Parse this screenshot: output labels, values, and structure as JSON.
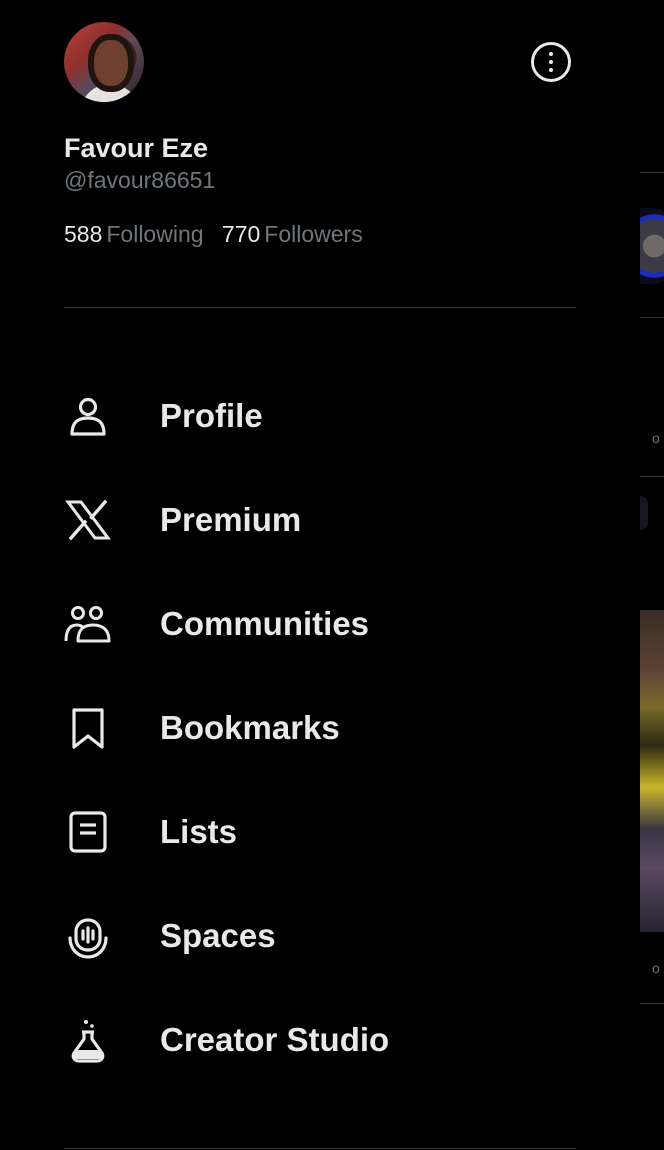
{
  "profile": {
    "display_name": "Favour Eze",
    "handle": "@favour86651",
    "following_count": "588",
    "following_label": "Following",
    "followers_count": "770",
    "followers_label": "Followers"
  },
  "menu": {
    "items": [
      {
        "label": "Profile",
        "icon": "person-icon"
      },
      {
        "label": "Premium",
        "icon": "x-logo-icon"
      },
      {
        "label": "Communities",
        "icon": "communities-icon"
      },
      {
        "label": "Bookmarks",
        "icon": "bookmark-icon"
      },
      {
        "label": "Lists",
        "icon": "list-icon"
      },
      {
        "label": "Spaces",
        "icon": "spaces-icon"
      },
      {
        "label": "Creator Studio",
        "icon": "flask-icon"
      }
    ]
  },
  "colors": {
    "background": "#000000",
    "primary_text": "#e7e9ea",
    "secondary_text": "#71767b",
    "divider": "#2f3336"
  }
}
